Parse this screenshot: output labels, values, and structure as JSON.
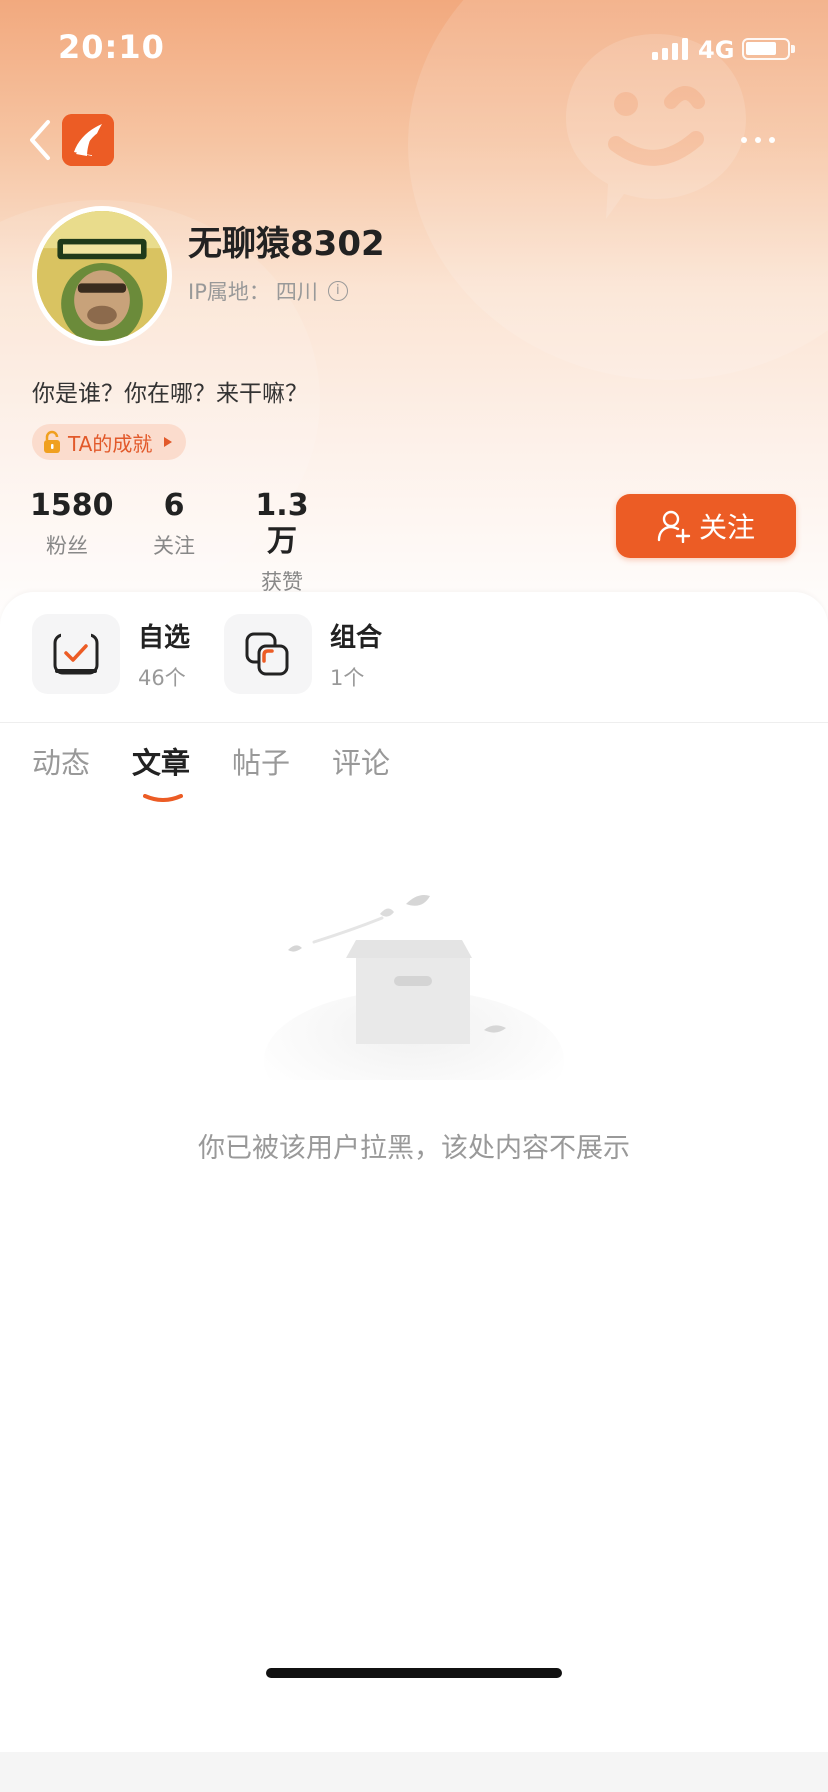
{
  "status_bar": {
    "time": "20:10",
    "network": "4G"
  },
  "profile": {
    "username": "无聊猿8302",
    "ip_label": "IP属地：",
    "ip_value": "四川",
    "bio": "你是谁？你在哪？来干嘛？",
    "achievement_label": "TA的成就"
  },
  "stats": [
    {
      "value": "1580",
      "label": "粉丝"
    },
    {
      "value": "6",
      "label": "关注"
    },
    {
      "value": "1.3万",
      "label": "获赞"
    }
  ],
  "follow_button": {
    "label": "关注"
  },
  "quick_links": [
    {
      "title": "自选",
      "count": "46个",
      "icon": "checkmark-icon"
    },
    {
      "title": "组合",
      "count": "1个",
      "icon": "combo-icon"
    }
  ],
  "tabs": [
    {
      "label": "动态",
      "active": false
    },
    {
      "label": "文章",
      "active": true
    },
    {
      "label": "帖子",
      "active": false
    },
    {
      "label": "评论",
      "active": false
    }
  ],
  "empty_state": {
    "message": "你已被该用户拉黑，该处内容不展示"
  },
  "colors": {
    "accent": "#ec5c25",
    "header_top": "#f2a97e",
    "muted_text": "#999999"
  }
}
